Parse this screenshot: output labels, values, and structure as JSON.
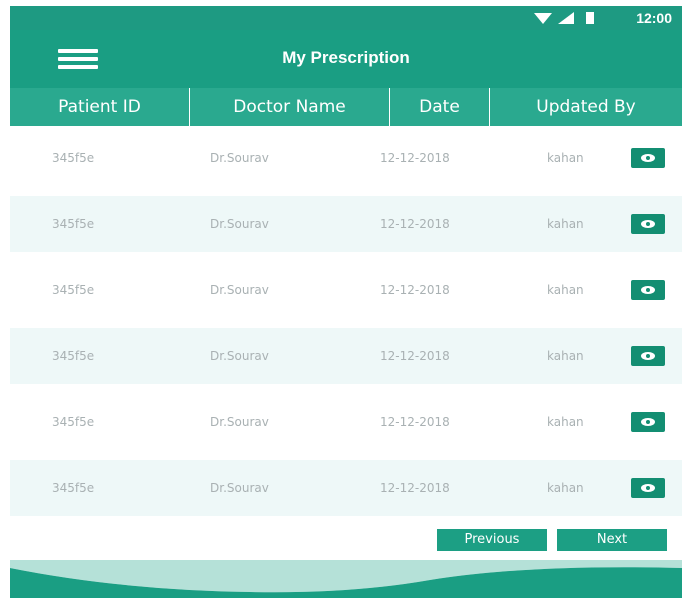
{
  "status_bar": {
    "time": "12:00"
  },
  "app_bar": {
    "title": "My Prescription",
    "menu_icon": "hamburger-menu-icon"
  },
  "table": {
    "columns": [
      "Patient ID",
      "Doctor Name",
      "Date",
      "Updated By"
    ],
    "rows": [
      {
        "patient_id": "345f5e",
        "doctor": "Dr.Sourav",
        "date": "12-12-2018",
        "updated_by": "kahan",
        "action_icon": "eye-icon"
      },
      {
        "patient_id": "345f5e",
        "doctor": "Dr.Sourav",
        "date": "12-12-2018",
        "updated_by": "kahan",
        "action_icon": "eye-icon"
      },
      {
        "patient_id": "345f5e",
        "doctor": "Dr.Sourav",
        "date": "12-12-2018",
        "updated_by": "kahan",
        "action_icon": "eye-icon"
      },
      {
        "patient_id": "345f5e",
        "doctor": "Dr.Sourav",
        "date": "12-12-2018",
        "updated_by": "kahan",
        "action_icon": "eye-icon"
      },
      {
        "patient_id": "345f5e",
        "doctor": "Dr.Sourav",
        "date": "12-12-2018",
        "updated_by": "kahan",
        "action_icon": "eye-icon"
      },
      {
        "patient_id": "345f5e",
        "doctor": "Dr.Sourav",
        "date": "12-12-2018",
        "updated_by": "kahan",
        "action_icon": "eye-icon"
      }
    ]
  },
  "pagination": {
    "previous_label": "Previous",
    "next_label": "Next"
  },
  "colors": {
    "primary": "#1a9e83",
    "header": "#2aa98f",
    "button": "#1c9f84",
    "row_alt": "#eef8f8",
    "cell_text": "#a9b1b3"
  }
}
